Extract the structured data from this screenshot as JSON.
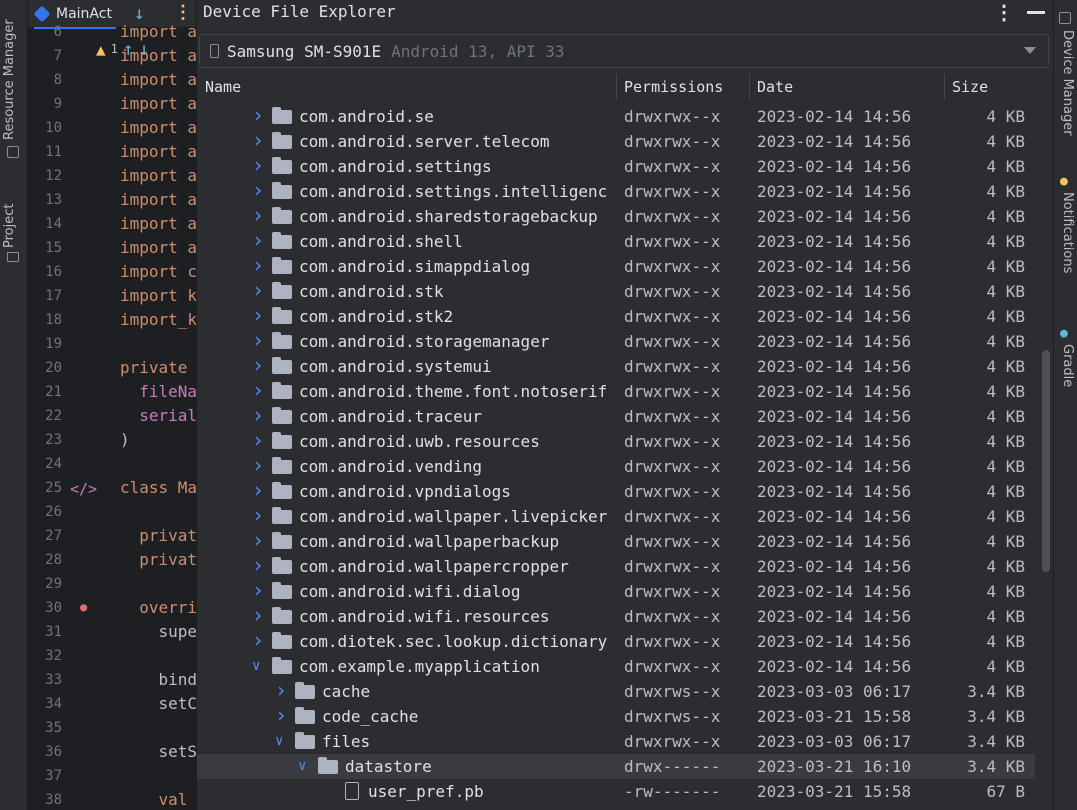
{
  "left_tools": {
    "resource_manager": "Resource Manager",
    "project": "Project"
  },
  "right_tools": {
    "device_manager": "Device Manager",
    "notifications": "Notifications",
    "gradle": "Gradle"
  },
  "editor": {
    "tab_label": "MainAct",
    "problems_count": "1",
    "lines": [
      {
        "n": "6",
        "t": "import a"
      },
      {
        "n": "7",
        "t": "import a"
      },
      {
        "n": "8",
        "t": "import a"
      },
      {
        "n": "9",
        "t": "import a"
      },
      {
        "n": "10",
        "t": "import a"
      },
      {
        "n": "11",
        "t": "import a"
      },
      {
        "n": "12",
        "t": "import a"
      },
      {
        "n": "13",
        "t": "import a"
      },
      {
        "n": "14",
        "t": "import a"
      },
      {
        "n": "15",
        "t": "import a"
      },
      {
        "n": "16",
        "t": "import c"
      },
      {
        "n": "17",
        "t": "import k"
      },
      {
        "n": "18",
        "t": "import_k"
      },
      {
        "n": "19",
        "t": ""
      },
      {
        "n": "20",
        "t": "private"
      },
      {
        "n": "21",
        "t": "  fileNa"
      },
      {
        "n": "22",
        "t": "  serial"
      },
      {
        "n": "23",
        "t": ")"
      },
      {
        "n": "24",
        "t": ""
      },
      {
        "n": "25",
        "t": "class Ma"
      },
      {
        "n": "26",
        "t": ""
      },
      {
        "n": "27",
        "t": "  privat"
      },
      {
        "n": "28",
        "t": "  privat"
      },
      {
        "n": "29",
        "t": ""
      },
      {
        "n": "30",
        "t": "  overri"
      },
      {
        "n": "31",
        "t": "    supe"
      },
      {
        "n": "32",
        "t": ""
      },
      {
        "n": "33",
        "t": "    bind"
      },
      {
        "n": "34",
        "t": "    setC"
      },
      {
        "n": "35",
        "t": ""
      },
      {
        "n": "36",
        "t": "    setS"
      },
      {
        "n": "37",
        "t": ""
      },
      {
        "n": "38",
        "t": "    val"
      }
    ]
  },
  "explorer": {
    "title": "Device File Explorer",
    "device_name": "Samsung SM-S901E",
    "device_info": "Android 13, API 33",
    "columns": {
      "name": "Name",
      "permissions": "Permissions",
      "date": "Date",
      "size": "Size"
    },
    "rows": [
      {
        "name": "com.android.se",
        "perm": "drwxrwx--x",
        "date": "2023-02-14 14:56",
        "size": "4 KB",
        "depth": 0,
        "type": "folder",
        "expanded": false
      },
      {
        "name": "com.android.server.telecom",
        "perm": "drwxrwx--x",
        "date": "2023-02-14 14:56",
        "size": "4 KB",
        "depth": 0,
        "type": "folder",
        "expanded": false
      },
      {
        "name": "com.android.settings",
        "perm": "drwxrwx--x",
        "date": "2023-02-14 14:56",
        "size": "4 KB",
        "depth": 0,
        "type": "folder",
        "expanded": false
      },
      {
        "name": "com.android.settings.intelligenc",
        "perm": "drwxrwx--x",
        "date": "2023-02-14 14:56",
        "size": "4 KB",
        "depth": 0,
        "type": "folder",
        "expanded": false
      },
      {
        "name": "com.android.sharedstoragebackup",
        "perm": "drwxrwx--x",
        "date": "2023-02-14 14:56",
        "size": "4 KB",
        "depth": 0,
        "type": "folder",
        "expanded": false
      },
      {
        "name": "com.android.shell",
        "perm": "drwxrwx--x",
        "date": "2023-02-14 14:56",
        "size": "4 KB",
        "depth": 0,
        "type": "folder",
        "expanded": false
      },
      {
        "name": "com.android.simappdialog",
        "perm": "drwxrwx--x",
        "date": "2023-02-14 14:56",
        "size": "4 KB",
        "depth": 0,
        "type": "folder",
        "expanded": false
      },
      {
        "name": "com.android.stk",
        "perm": "drwxrwx--x",
        "date": "2023-02-14 14:56",
        "size": "4 KB",
        "depth": 0,
        "type": "folder",
        "expanded": false
      },
      {
        "name": "com.android.stk2",
        "perm": "drwxrwx--x",
        "date": "2023-02-14 14:56",
        "size": "4 KB",
        "depth": 0,
        "type": "folder",
        "expanded": false
      },
      {
        "name": "com.android.storagemanager",
        "perm": "drwxrwx--x",
        "date": "2023-02-14 14:56",
        "size": "4 KB",
        "depth": 0,
        "type": "folder",
        "expanded": false
      },
      {
        "name": "com.android.systemui",
        "perm": "drwxrwx--x",
        "date": "2023-02-14 14:56",
        "size": "4 KB",
        "depth": 0,
        "type": "folder",
        "expanded": false
      },
      {
        "name": "com.android.theme.font.notoserif",
        "perm": "drwxrwx--x",
        "date": "2023-02-14 14:56",
        "size": "4 KB",
        "depth": 0,
        "type": "folder",
        "expanded": false
      },
      {
        "name": "com.android.traceur",
        "perm": "drwxrwx--x",
        "date": "2023-02-14 14:56",
        "size": "4 KB",
        "depth": 0,
        "type": "folder",
        "expanded": false
      },
      {
        "name": "com.android.uwb.resources",
        "perm": "drwxrwx--x",
        "date": "2023-02-14 14:56",
        "size": "4 KB",
        "depth": 0,
        "type": "folder",
        "expanded": false
      },
      {
        "name": "com.android.vending",
        "perm": "drwxrwx--x",
        "date": "2023-02-14 14:56",
        "size": "4 KB",
        "depth": 0,
        "type": "folder",
        "expanded": false
      },
      {
        "name": "com.android.vpndialogs",
        "perm": "drwxrwx--x",
        "date": "2023-02-14 14:56",
        "size": "4 KB",
        "depth": 0,
        "type": "folder",
        "expanded": false
      },
      {
        "name": "com.android.wallpaper.livepicker",
        "perm": "drwxrwx--x",
        "date": "2023-02-14 14:56",
        "size": "4 KB",
        "depth": 0,
        "type": "folder",
        "expanded": false
      },
      {
        "name": "com.android.wallpaperbackup",
        "perm": "drwxrwx--x",
        "date": "2023-02-14 14:56",
        "size": "4 KB",
        "depth": 0,
        "type": "folder",
        "expanded": false
      },
      {
        "name": "com.android.wallpapercropper",
        "perm": "drwxrwx--x",
        "date": "2023-02-14 14:56",
        "size": "4 KB",
        "depth": 0,
        "type": "folder",
        "expanded": false
      },
      {
        "name": "com.android.wifi.dialog",
        "perm": "drwxrwx--x",
        "date": "2023-02-14 14:56",
        "size": "4 KB",
        "depth": 0,
        "type": "folder",
        "expanded": false
      },
      {
        "name": "com.android.wifi.resources",
        "perm": "drwxrwx--x",
        "date": "2023-02-14 14:56",
        "size": "4 KB",
        "depth": 0,
        "type": "folder",
        "expanded": false
      },
      {
        "name": "com.diotek.sec.lookup.dictionary",
        "perm": "drwxrwx--x",
        "date": "2023-02-14 14:56",
        "size": "4 KB",
        "depth": 0,
        "type": "folder",
        "expanded": false
      },
      {
        "name": "com.example.myapplication",
        "perm": "drwxrwx--x",
        "date": "2023-02-14 14:56",
        "size": "4 KB",
        "depth": 0,
        "type": "folder",
        "expanded": true
      },
      {
        "name": "cache",
        "perm": "drwxrws--x",
        "date": "2023-03-03 06:17",
        "size": "3.4 KB",
        "depth": 1,
        "type": "folder",
        "expanded": false
      },
      {
        "name": "code_cache",
        "perm": "drwxrws--x",
        "date": "2023-03-21 15:58",
        "size": "3.4 KB",
        "depth": 1,
        "type": "folder",
        "expanded": false
      },
      {
        "name": "files",
        "perm": "drwxrwx--x",
        "date": "2023-03-03 06:17",
        "size": "3.4 KB",
        "depth": 1,
        "type": "folder",
        "expanded": true
      },
      {
        "name": "datastore",
        "perm": "drwx------",
        "date": "2023-03-21 16:10",
        "size": "3.4 KB",
        "depth": 2,
        "type": "folder",
        "expanded": true,
        "selected": true
      },
      {
        "name": "user_pref.pb",
        "perm": "-rw-------",
        "date": "2023-03-21 15:58",
        "size": "67 B",
        "depth": 3,
        "type": "file"
      }
    ]
  }
}
